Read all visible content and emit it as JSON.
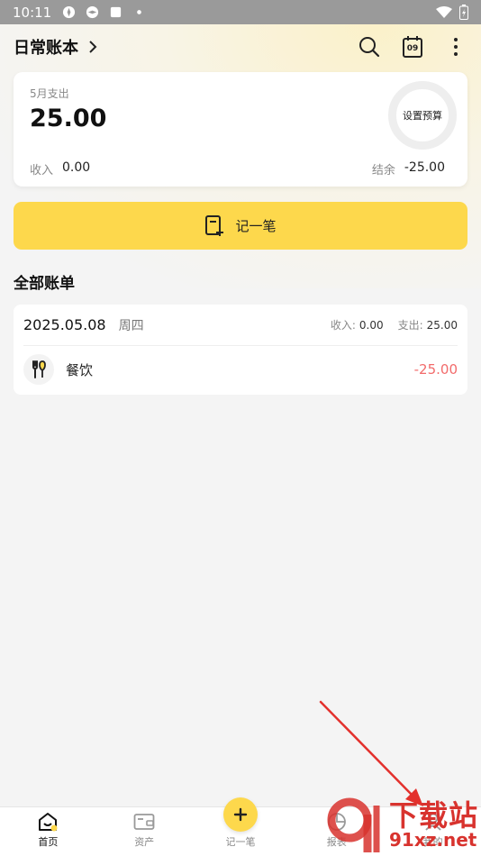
{
  "status_bar": {
    "time": "10:11"
  },
  "header": {
    "book_title": "日常账本"
  },
  "summary": {
    "month_label": "5月支出",
    "month_expense": "25.00",
    "budget_label": "设置预算",
    "income_label": "收入",
    "income_value": "0.00",
    "balance_label": "结余",
    "balance_value": "-25.00"
  },
  "record_button": {
    "label": "记一笔"
  },
  "bills": {
    "section_title": "全部账单",
    "groups": [
      {
        "date": "2025.05.08",
        "weekday": "周四",
        "income_label": "收入:",
        "income_value": "0.00",
        "expense_label": "支出:",
        "expense_value": "25.00",
        "items": [
          {
            "category": "餐饮",
            "amount": "-25.00",
            "icon": "fork-knife-icon"
          }
        ]
      }
    ]
  },
  "calendar": {
    "day": "09"
  },
  "bottom_nav": {
    "items": [
      {
        "label": "首页",
        "icon": "home-icon",
        "active": true
      },
      {
        "label": "资产",
        "icon": "wallet-icon"
      },
      {
        "label": "记一笔",
        "icon": "plus-icon"
      },
      {
        "label": "报表",
        "icon": "report-icon"
      },
      {
        "label": "我的",
        "icon": "profile-icon"
      }
    ]
  },
  "watermark": {
    "text": "下载站",
    "url": "91xz.net"
  },
  "colors": {
    "accent": "#fdd84c",
    "expense": "#f26b6b",
    "watermark": "#d8332e"
  }
}
